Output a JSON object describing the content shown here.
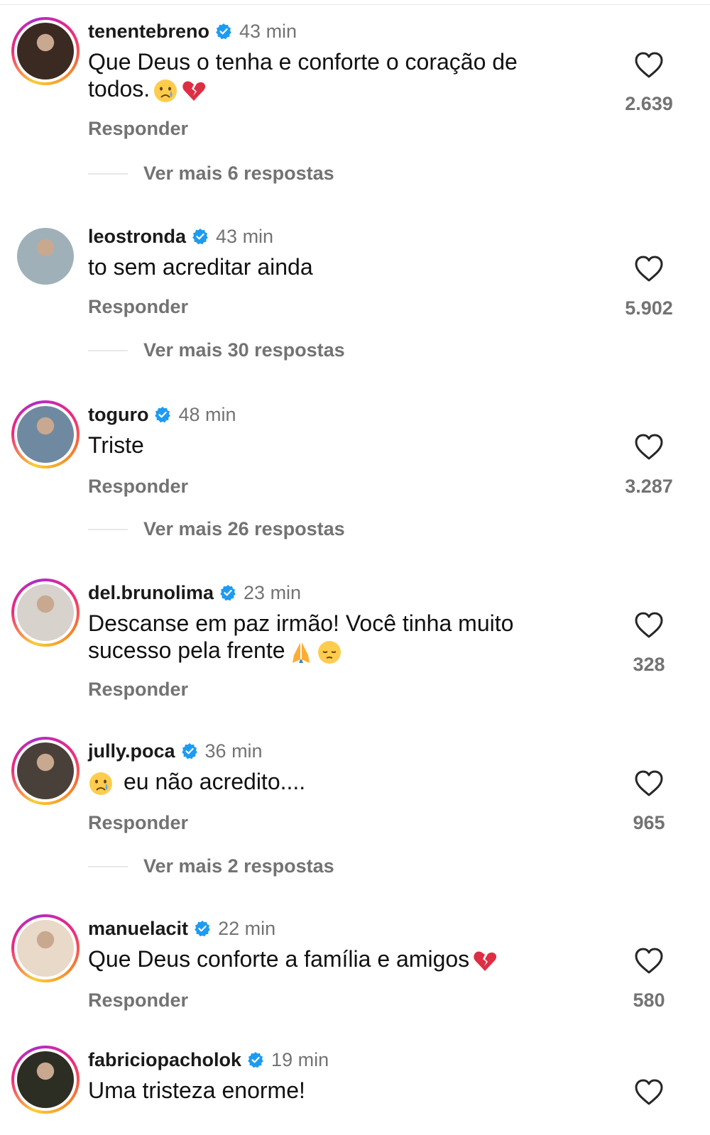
{
  "comments": [
    {
      "username": "tenentebreno",
      "time": "43 min",
      "text": "Que Deus o tenha e conforte o coração de todos.",
      "emojis": [
        "crying-face",
        "broken-heart"
      ],
      "reply": "Responder",
      "likes": "2.639",
      "more_replies": "Ver mais 6 respostas",
      "avatar_color": "#3a2a22"
    },
    {
      "username": "leostronda",
      "time": "43 min",
      "text": "to sem acreditar ainda",
      "emojis": [],
      "reply": "Responder",
      "likes": "5.902",
      "more_replies": "Ver mais 30 respostas",
      "avatar_color": "#9fb0b8"
    },
    {
      "username": "toguro",
      "time": "48 min",
      "text": "Triste",
      "emojis": [],
      "reply": "Responder",
      "likes": "3.287",
      "more_replies": "Ver mais 26 respostas",
      "avatar_color": "#6f8aa0"
    },
    {
      "username": "del.brunolima",
      "time": "23 min",
      "text": "Descanse em paz irmão! Você tinha muito sucesso pela frente",
      "emojis": [
        "folded-hands",
        "pensive-face"
      ],
      "reply": "Responder",
      "likes": "328",
      "more_replies": "",
      "avatar_color": "#d7d2cc"
    },
    {
      "username": "jully.poca",
      "time": "36 min",
      "text": "eu não acredito....",
      "emojis": [
        "crying-face"
      ],
      "reply": "Responder",
      "likes": "965",
      "more_replies": "Ver mais 2 respostas",
      "avatar_color": "#4a403a"
    },
    {
      "username": "manuelacit",
      "time": "22 min",
      "text": "Que Deus conforte a família e amigos",
      "emojis": [
        "broken-heart"
      ],
      "reply": "Responder",
      "likes": "580",
      "more_replies": "",
      "avatar_color": "#e9d9c8"
    },
    {
      "username": "fabriciopacholok",
      "time": "19 min",
      "text": "Uma tristeza enorme!",
      "emojis": [],
      "reply": "",
      "likes": "",
      "more_replies": "",
      "avatar_color": "#2c2e24"
    }
  ],
  "colors": {
    "verified": "#1d9bf0",
    "secondary_text": "#737373",
    "primary_text": "#111111"
  }
}
